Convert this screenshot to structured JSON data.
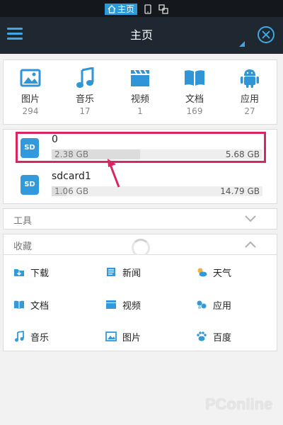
{
  "status_bar": {
    "active_tab": "主页",
    "icons": [
      "phone-icon",
      "multiwindow-icon"
    ]
  },
  "header": {
    "title": "主页",
    "menu_icon": "hamburger-menu-icon",
    "close_icon": "close-circle-icon",
    "accent": "#3fa7e6"
  },
  "categories": [
    {
      "label": "图片",
      "count": "294",
      "icon": "image-icon"
    },
    {
      "label": "音乐",
      "count": "17",
      "icon": "music-icon"
    },
    {
      "label": "视频",
      "count": "1",
      "icon": "video-icon"
    },
    {
      "label": "文档",
      "count": "169",
      "icon": "document-icon"
    },
    {
      "label": "应用",
      "count": "27",
      "icon": "android-icon"
    }
  ],
  "storage": [
    {
      "badge": "SD",
      "name": "0",
      "used": "2.38 GB",
      "total": "5.68 GB",
      "used_fraction": 0.42
    },
    {
      "badge": "SD",
      "name": "sdcard1",
      "used": "1.06 GB",
      "total": "14.79 GB",
      "used_fraction": 0.07
    }
  ],
  "sections": {
    "tools": "工具",
    "favorites": "收藏"
  },
  "favorites": [
    {
      "label": "下载",
      "icon": "download-icon"
    },
    {
      "label": "新闻",
      "icon": "news-icon"
    },
    {
      "label": "天气",
      "icon": "weather-icon"
    },
    {
      "label": "文档",
      "icon": "book-icon"
    },
    {
      "label": "视频",
      "icon": "video-icon"
    },
    {
      "label": "应用",
      "icon": "apps-icon"
    },
    {
      "label": "音乐",
      "icon": "music-icon"
    },
    {
      "label": "图片",
      "icon": "image-icon"
    },
    {
      "label": "百度",
      "icon": "baidu-paw-icon"
    }
  ],
  "watermark": "PConline",
  "colors": {
    "accent": "#3399dd",
    "highlight": "#d8265f",
    "header_bg": "#1f2830"
  }
}
